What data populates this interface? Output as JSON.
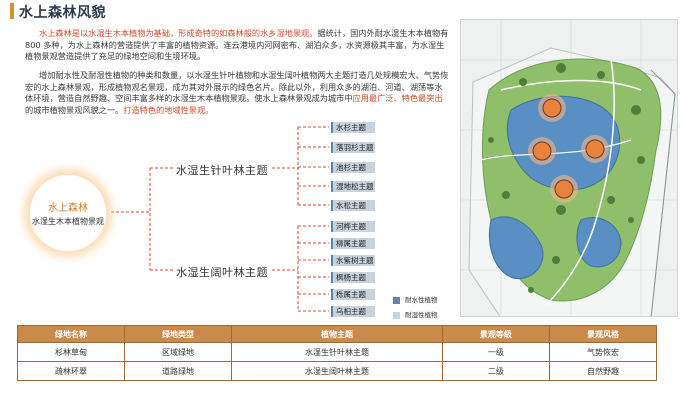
{
  "page": {
    "title": "水上森林风貌"
  },
  "intro": {
    "p1_highlight": "水上森林是以水湿生木本植物为基础，形成奇特的如森林般的水乡湿地景观。",
    "p1_rest": "据统计，国内外耐水湿生木本植物有 800 多种，为水上森林的营造提供了丰富的植物资源。连云港境内河网密布、湖泊众多，水资源极其丰富，为水湿生植物景观营造提供了充足的绿地空间和生境环境。",
    "p2_text": "增加耐水性及耐湿性植物的种类和数量，以水湿生针叶植物和水湿生阔叶植物两大主题打造几处规模宏大、气势恢宏的水上森林景观，形成植物观名景观，成为其对外展示的绿色名片。除此以外，利用众多的湖泊、河道、湖荡等水体环境，营造自然野趣、空间丰富多样的水湿生木本植物景观。使水上森林景观成为城市中",
    "p2_highlight": "应用最广泛、特色最突出",
    "p2_mid": "的城市植物景观风貌之一。",
    "p2_end": "打造特色的地域性景观。"
  },
  "center": {
    "title": "水上森林",
    "subtitle": "水湿生木本植物景观"
  },
  "themes": [
    {
      "label": "水湿生针叶林主题",
      "species": [
        "水杉主题",
        "落羽杉主题",
        "池杉主题",
        "湿地松主题",
        "水松主题"
      ]
    },
    {
      "label": "水湿生阔叶林主题",
      "species": [
        "河桦主题",
        "柳属主题",
        "水紫树主题",
        "枫杨主题",
        "栎属主题",
        "乌桕主题"
      ]
    }
  ],
  "legend": [
    {
      "label": "耐水性植物",
      "color": "#5f86a8"
    },
    {
      "label": "耐湿性植物",
      "color": "#c9d3dd"
    }
  ],
  "table": {
    "headers": [
      "绿地名称",
      "绿地类型",
      "植物主题",
      "景观等级",
      "景观风格"
    ],
    "rows": [
      [
        "杉林草甸",
        "区域绿地",
        "水湿生针叶林主题",
        "一级",
        "气势恢宏"
      ],
      [
        "疏林环翠",
        "道路绿地",
        "水湿生阔叶林主题",
        "二级",
        "自然野趣"
      ]
    ]
  },
  "colors": {
    "accent": "#d8922b",
    "table_header": "#c98a4b",
    "highlight": "#d14b2a",
    "marker": "#e9823b"
  }
}
